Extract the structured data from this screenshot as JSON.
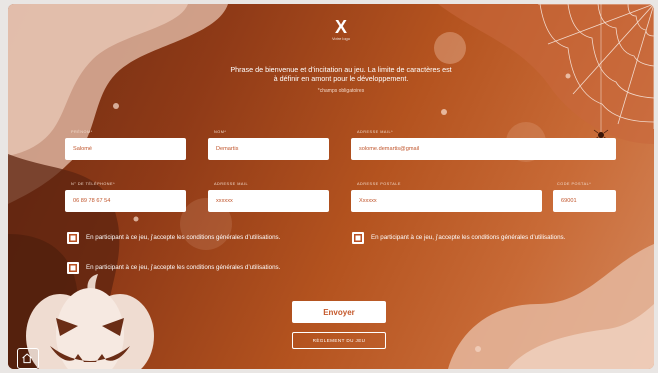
{
  "header": {
    "logo_mark": "X",
    "logo_sub": "Votre logo",
    "intro_line1": "Phrase de bienvenue et d’incitation au jeu. La limite de caractères est",
    "intro_line2": "à définir en amont pour le développement.",
    "required_note": "*champs obligatoires"
  },
  "form": {
    "row1": [
      {
        "label": "Prénom*",
        "value": "Salomé"
      },
      {
        "label": "Nom*",
        "value": "Demartis"
      },
      {
        "label": "Adresse mail*",
        "value": "solome.demartis@gmail"
      }
    ],
    "row2": [
      {
        "label": "N° de téléphone*",
        "value": "06 89 78 67 54"
      },
      {
        "label": "Adresse mail",
        "value": "xxxxxx"
      },
      {
        "label": "Adresse postale",
        "value": "Xxxxxx"
      },
      {
        "label": "Code postal*",
        "value": "69001"
      }
    ]
  },
  "consents": [
    {
      "text": "En participant à ce jeu, j’accepte les conditions générales d’utilisations."
    },
    {
      "text": "En participant à ce jeu, j’accepte les conditions générales d’utilisations."
    },
    {
      "text": "En participant à ce jeu, j’accepte les conditions générales d’utilisations."
    }
  ],
  "buttons": {
    "submit": "Envoyer",
    "rules": "RÈGLEMENT DU JEU"
  },
  "icons": {
    "home": "home-icon",
    "pumpkin": "pumpkin-icon",
    "spiderweb": "spiderweb-icon"
  },
  "colors": {
    "background_dark": "#6e2c12",
    "background_mid": "#b4531f",
    "accent_text": "#c5582b",
    "field_bg": "#ffffff"
  }
}
